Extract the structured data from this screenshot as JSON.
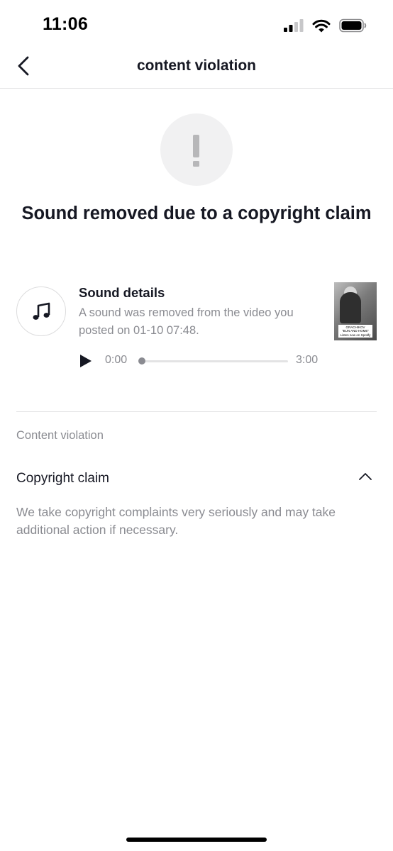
{
  "status_bar": {
    "time": "11:06",
    "icons": [
      "cellular-signal-icon",
      "wifi-icon",
      "battery-icon"
    ]
  },
  "nav": {
    "title": "content violation",
    "back_icon": "chevron-left-icon"
  },
  "alert": {
    "icon": "exclamation-icon"
  },
  "headline": "Sound removed due to a copyright claim",
  "sound": {
    "icon": "music-note-icon",
    "title": "Sound details",
    "description": "A sound was removed from the video you posted on 01-10 07:48.",
    "thumbnail_caption_lines": [
      "GRACHIKOV",
      "\"BUN AND HOME\"",
      "Listen now on Spotify"
    ],
    "player": {
      "play_icon": "play-icon",
      "current_time": "0:00",
      "duration": "3:00",
      "progress": 0
    }
  },
  "violation": {
    "section_label": "Content violation",
    "claim_title": "Copyright claim",
    "claim_toggle_icon": "chevron-up-icon",
    "claim_description": "We take copyright complaints very seriously and may take additional action if necessary."
  },
  "colors": {
    "text_primary": "#161823",
    "text_secondary": "#8a8b91",
    "divider": "#e3e3e4",
    "icon_circle_bg": "#f1f1f2",
    "exclamation": "#b7b7b9"
  }
}
